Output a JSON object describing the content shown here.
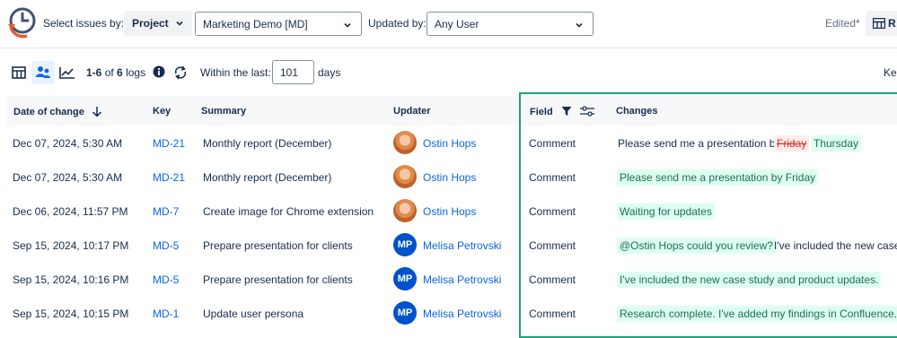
{
  "header": {
    "select_by_label": "Select issues by:",
    "project_button": "Project",
    "project_select": "Marketing Demo [MD]",
    "updated_by_label": "Updated by:",
    "user_select": "Any User",
    "edited": "Edited*",
    "right_button": "R"
  },
  "toolbar": {
    "range": "1-6",
    "of": "of",
    "total": "6",
    "logs": "logs",
    "within_label": "Within the last:",
    "days_value": "101",
    "days_label": "days",
    "right_text": "Kee"
  },
  "columns": {
    "date": "Date of change",
    "key": "Key",
    "summary": "Summary",
    "updater": "Updater",
    "field": "Field",
    "changes": "Changes"
  },
  "rows": [
    {
      "date": "Dec 07, 2024, 5:30 AM",
      "key": "MD-21",
      "summary": "Monthly report (December)",
      "updater": "Ostin Hops",
      "avatar": "photo",
      "field": "Comment",
      "change_text": "Please send me a presentation by",
      "change_removed": "Friday",
      "change_added": "Thursday"
    },
    {
      "date": "Dec 07, 2024, 5:30 AM",
      "key": "MD-21",
      "summary": "Monthly report (December)",
      "updater": "Ostin Hops",
      "avatar": "photo",
      "field": "Comment",
      "change_added": "Please send me a presentation by Friday"
    },
    {
      "date": "Dec 06, 2024, 11:57 PM",
      "key": "MD-7",
      "summary": "Create image for Chrome extension",
      "updater": "Ostin Hops",
      "avatar": "photo",
      "field": "Comment",
      "change_added": "Waiting for updates"
    },
    {
      "date": "Sep 15, 2024, 10:17 PM",
      "key": "MD-5",
      "summary": "Prepare presentation for clients",
      "updater": "Melisa Petrovski",
      "avatar": "MP",
      "field": "Comment",
      "change_added": "@Ostin Hops could you review?",
      "change_tail": "I've included the new case"
    },
    {
      "date": "Sep 15, 2024, 10:16 PM",
      "key": "MD-5",
      "summary": "Prepare presentation for clients",
      "updater": "Melisa Petrovski",
      "avatar": "MP",
      "field": "Comment",
      "change_added": "I've included the new case study and product updates."
    },
    {
      "date": "Sep 15, 2024, 10:15 PM",
      "key": "MD-1",
      "summary": "Update user persona",
      "updater": "Melisa Petrovski",
      "avatar": "MP",
      "field": "Comment",
      "change_added": "Research complete. I've added my findings in Confluence."
    }
  ],
  "colors": {
    "link": "#0c66e4",
    "added_bg": "#dcfff1",
    "added_text": "#216e4e",
    "removed_bg": "#ffeceb",
    "removed_text": "#c9372c",
    "highlight": "#1f9e7a",
    "avatar_mp": "#0052cc"
  }
}
